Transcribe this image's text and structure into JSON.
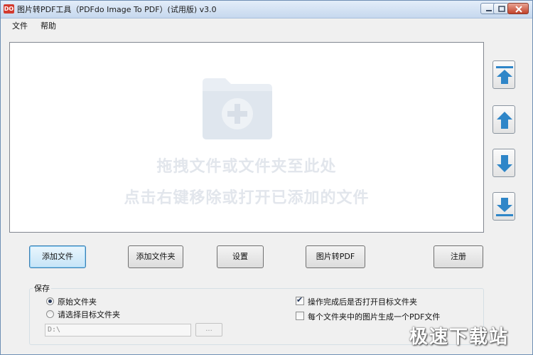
{
  "window": {
    "title": "图片转PDF工具（PDFdo Image To PDF）(试用版) v3.0",
    "app_icon_text": "DO"
  },
  "menu": [
    "文件",
    "帮助"
  ],
  "drop_area": {
    "line1": "拖拽文件或文件夹至此处",
    "line2": "点击右键移除或打开已添加的文件",
    "icon": "folder-plus-icon"
  },
  "side_buttons": [
    {
      "name": "move-top-button",
      "icon": "arrow-to-top-icon"
    },
    {
      "name": "move-up-button",
      "icon": "arrow-up-icon"
    },
    {
      "name": "move-down-button",
      "icon": "arrow-down-icon"
    },
    {
      "name": "move-bottom-button",
      "icon": "arrow-to-bottom-icon"
    }
  ],
  "buttons": {
    "add_file": "添加文件",
    "add_folder": "添加文件夹",
    "settings": "设置",
    "convert": "图片转PDF",
    "register": "注册"
  },
  "save": {
    "group_label": "保存",
    "option_original": "原始文件夹",
    "option_choose": "请选择目标文件夹",
    "selected": "原始文件夹",
    "path_value": "D:\\",
    "browse_label": "...",
    "open_after_label": "操作完成后是否打开目标文件夹",
    "open_after_checked": true,
    "one_pdf_per_folder_label": "每个文件夹中的图片生成一个PDF文件",
    "one_pdf_per_folder_checked": false
  },
  "watermark": "极速下载站",
  "colors": {
    "arrow_blue": "#2f86c8",
    "drop_text": "#e2e6ec"
  }
}
